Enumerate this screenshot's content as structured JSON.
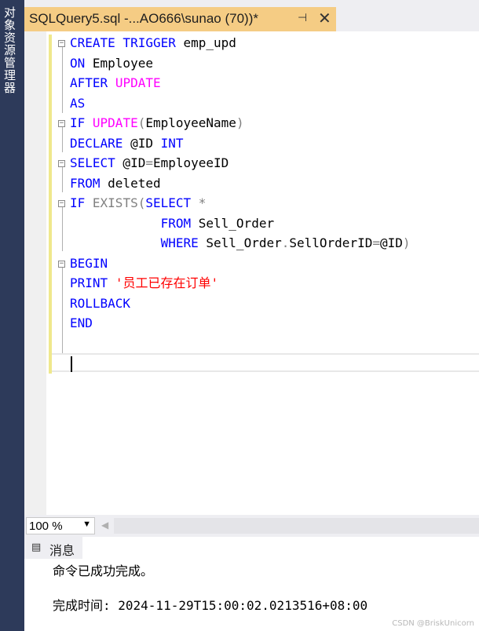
{
  "sidebar": {
    "label": "对象资源管理器"
  },
  "tab": {
    "title": "SQLQuery5.sql -...AO666\\sunao (70))*",
    "pin_glyph": "⊣",
    "close_glyph": "✕"
  },
  "code": {
    "l1": {
      "a": "CREATE TRIGGER",
      "b": " emp_upd"
    },
    "l2": {
      "a": "ON",
      "b": " Employee"
    },
    "l3": {
      "a": "AFTER",
      "b": "UPDATE"
    },
    "l4": {
      "a": "AS"
    },
    "l5": {
      "a": "IF",
      "b": "UPDATE",
      "c": "(",
      "d": "EmployeeName",
      "e": ")"
    },
    "l6": {
      "a": "DECLARE",
      "b": " @ID ",
      "c": "INT"
    },
    "l7": {
      "a": "SELECT",
      "b": " @ID",
      "c": "=",
      "d": "EmployeeID"
    },
    "l8": {
      "a": "FROM",
      "b": " deleted"
    },
    "l9": {
      "a": "IF",
      "b": "EXISTS",
      "c": "(",
      "d": "SELECT",
      "e": " *"
    },
    "l10": {
      "a": "FROM",
      "b": " Sell_Order"
    },
    "l11": {
      "a": "WHERE",
      "b": " Sell_Order",
      "c": ".",
      "d": "SellOrderID",
      "e": "=",
      "f": "@ID",
      "g": ")"
    },
    "l12": {
      "a": "BEGIN"
    },
    "l13": {
      "a": "PRINT",
      "b": "'员工已存在订单'"
    },
    "l14": {
      "a": "ROLLBACK"
    },
    "l15": {
      "a": "END"
    }
  },
  "status": {
    "zoom": "100 %"
  },
  "results": {
    "tab_label": "消息",
    "message": "命令已成功完成。",
    "completion": "完成时间: 2024-11-29T15:00:02.0213516+08:00"
  },
  "watermark": "CSDN @BriskUnicorn"
}
